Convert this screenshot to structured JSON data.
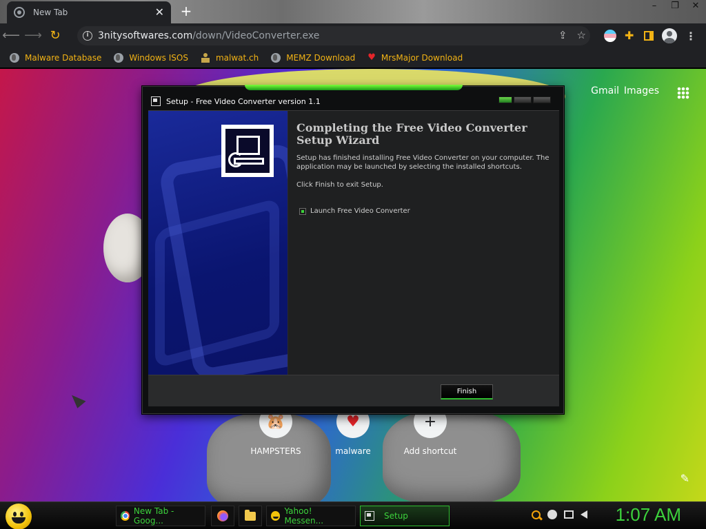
{
  "browser": {
    "tab_title": "New Tab",
    "url_host": "3nitysoftwares.com",
    "url_path": "/down/VideoConverter.exe",
    "bookmarks": [
      {
        "label": "Malware Database",
        "icon": "globe-icon"
      },
      {
        "label": "Windows ISOS",
        "icon": "globe-icon"
      },
      {
        "label": "malwat.ch",
        "icon": "figure-icon"
      },
      {
        "label": "MEMZ Download",
        "icon": "globe-icon"
      },
      {
        "label": "MrsMajor Download",
        "icon": "heart-icon"
      }
    ]
  },
  "newtab": {
    "links": [
      "Gmail",
      "Images"
    ],
    "shortcuts": [
      {
        "label": "HAMPSTERS",
        "icon": "hamster-icon"
      },
      {
        "label": "malware",
        "icon": "heart-icon"
      },
      {
        "label": "Add shortcut",
        "icon": "plus-icon"
      }
    ]
  },
  "dialog": {
    "title": "Setup - Free Video Converter version 1.1",
    "heading": "Completing the Free Video Converter Setup Wizard",
    "body": "Setup has finished installing Free Video Converter on your computer. The application may be launched by selecting the installed shortcuts.",
    "instruction": "Click Finish to exit Setup.",
    "checkbox_label": "Launch Free Video Converter",
    "checkbox_checked": true,
    "finish_label": "Finish"
  },
  "taskbar": {
    "tasks": [
      {
        "label": "New Tab - Goog...",
        "icon": "chrome-icon"
      },
      {
        "label": "Yahoo! Messen...",
        "icon": "yahoo-icon"
      },
      {
        "label": "Setup",
        "icon": "setup-icon"
      }
    ],
    "clock": "1:07 AM"
  },
  "colors": {
    "accent": "#f2b315",
    "taskbar_green": "#3cd23c"
  }
}
